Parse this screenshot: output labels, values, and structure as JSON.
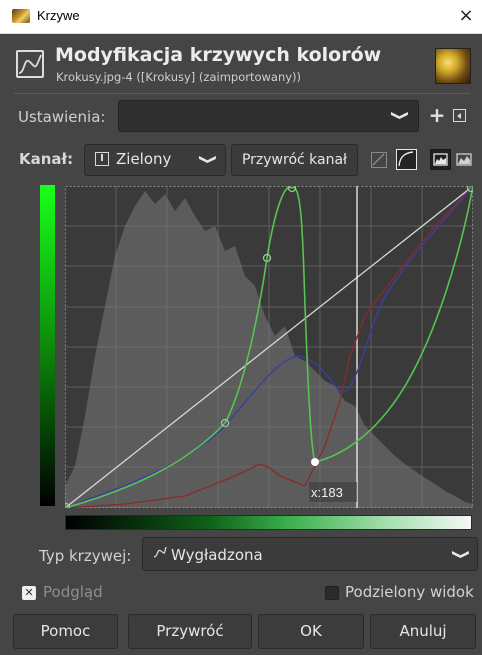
{
  "window": {
    "title": "Krzywe",
    "close_glyph": "×"
  },
  "header": {
    "title": "Modyfikacja krzywych kolorów",
    "subtitle": "Krokusy.jpg-4 ([Krokusy] (zaimportowany))",
    "icon": "curves-icon",
    "thumbnail": "image-thumbnail"
  },
  "settings": {
    "label": "Ustawienia:",
    "value": "",
    "add_glyph": "+"
  },
  "channel": {
    "label": "Kanał:",
    "value": "Zielony",
    "reset_label": "Przywróć kanał"
  },
  "graph": {
    "cursor_readout": "x:183",
    "colors": {
      "green": "#56c453",
      "blue": "#3b3fa0",
      "red": "#8a2a2a",
      "diagonal": "#d8d8d8",
      "histogram": "#6a6a6a"
    }
  },
  "curve_type": {
    "label": "Typ krzywej:",
    "value": "Wygładzona",
    "icon": "smooth-curve-icon"
  },
  "preview": {
    "label": "Podgląd",
    "checked": true,
    "check_glyph": "✕"
  },
  "split_view": {
    "label": "Podzielony widok",
    "checked": false
  },
  "buttons": {
    "help": "Pomoc",
    "reset": "Przywróć",
    "ok": "OK",
    "cancel": "Anuluj"
  },
  "chevron_glyph": "❯"
}
